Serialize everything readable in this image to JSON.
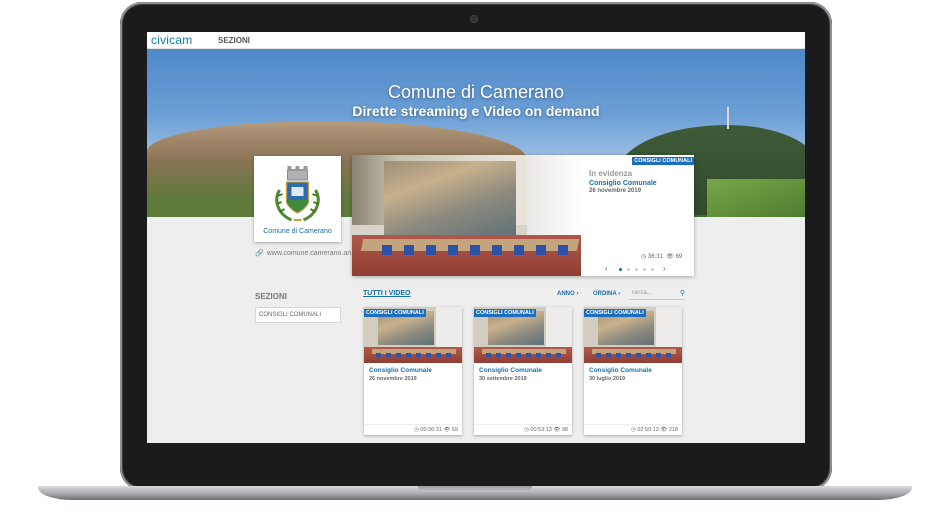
{
  "header": {
    "logo": "civicam",
    "nav_sezioni": "SEZIONI"
  },
  "hero": {
    "title": "Comune di Camerano",
    "subtitle": "Dirette streaming e Video on demand"
  },
  "crest": {
    "name": "Comune di Camerano",
    "website": "www.comune.camerano.an.it"
  },
  "featured": {
    "badge": "CONSIGLI COMUNALI",
    "label": "In evidenza",
    "title": "Consiglio Comunale",
    "date": "26 novembre 2019",
    "duration": "36:31",
    "views": "69",
    "carousel_dots": 6,
    "active_dot": 1
  },
  "sidebar": {
    "heading": "SEZIONI",
    "items": [
      {
        "label": "CONSIGLI COMUNALI"
      }
    ]
  },
  "filters": {
    "all_videos": "TUTTI I VIDEO",
    "year": "ANNO",
    "order": "ORDINA",
    "search_placeholder": "cerca..."
  },
  "videos": [
    {
      "badge": "CONSIGLI COMUNALI",
      "title": "Consiglio Comunale",
      "date": "26 novembre 2019",
      "duration": "00:36:31",
      "views": "69"
    },
    {
      "badge": "CONSIGLI COMUNALI",
      "title": "Consiglio Comunale",
      "date": "30 settembre 2019",
      "duration": "00:53:13",
      "views": "98"
    },
    {
      "badge": "CONSIGLI COMUNALI",
      "title": "Consiglio Comunale",
      "date": "30 luglio 2019",
      "duration": "02:59:13",
      "views": "218"
    }
  ],
  "icons": {
    "link": "link-icon",
    "clock": "clock-icon",
    "eye": "eye-icon",
    "search": "search-icon"
  },
  "colors": {
    "accent": "#1a6ea8",
    "badge": "#1d6fbe"
  }
}
